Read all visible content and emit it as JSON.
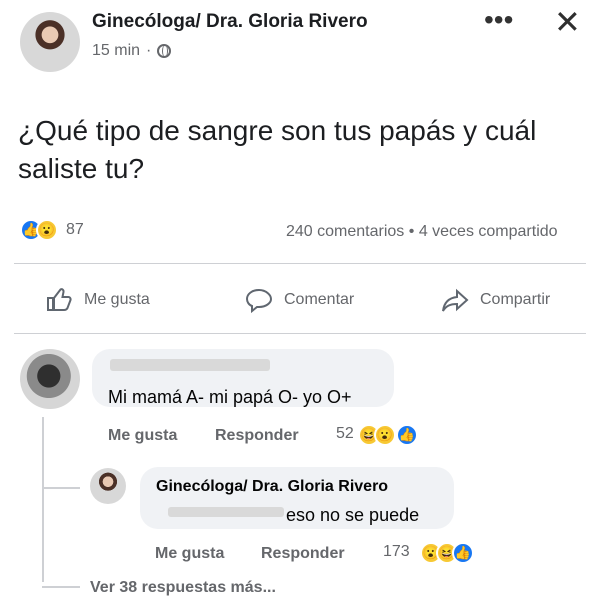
{
  "post": {
    "author": "Ginecóloga/ Dra. Gloria Rivero",
    "time": "15 min",
    "separator": "·",
    "privacy_icon": "globe-icon",
    "text": "¿Qué tipo de sangre son tus papás y cuál saliste tu?",
    "reaction_count": "87",
    "comments_count": "240 comentarios",
    "stats_separator": "•",
    "shares_count": "4 veces compartido"
  },
  "header_controls": {
    "more_label": "•••",
    "close_label": "✕"
  },
  "actions": {
    "like": "Me gusta",
    "comment": "Comentar",
    "share": "Compartir"
  },
  "comment": {
    "text": "Mi mamá A- mi papá O- yo O+",
    "like_label": "Me gusta",
    "reply_label": "Responder",
    "reaction_count": "52"
  },
  "reply": {
    "author": "Ginecóloga/ Dra. Gloria Rivero",
    "text": "eso no se puede",
    "like_label": "Me gusta",
    "reply_label": "Responder",
    "reaction_count": "173"
  },
  "more_replies": "Ver 38 respuestas más..."
}
